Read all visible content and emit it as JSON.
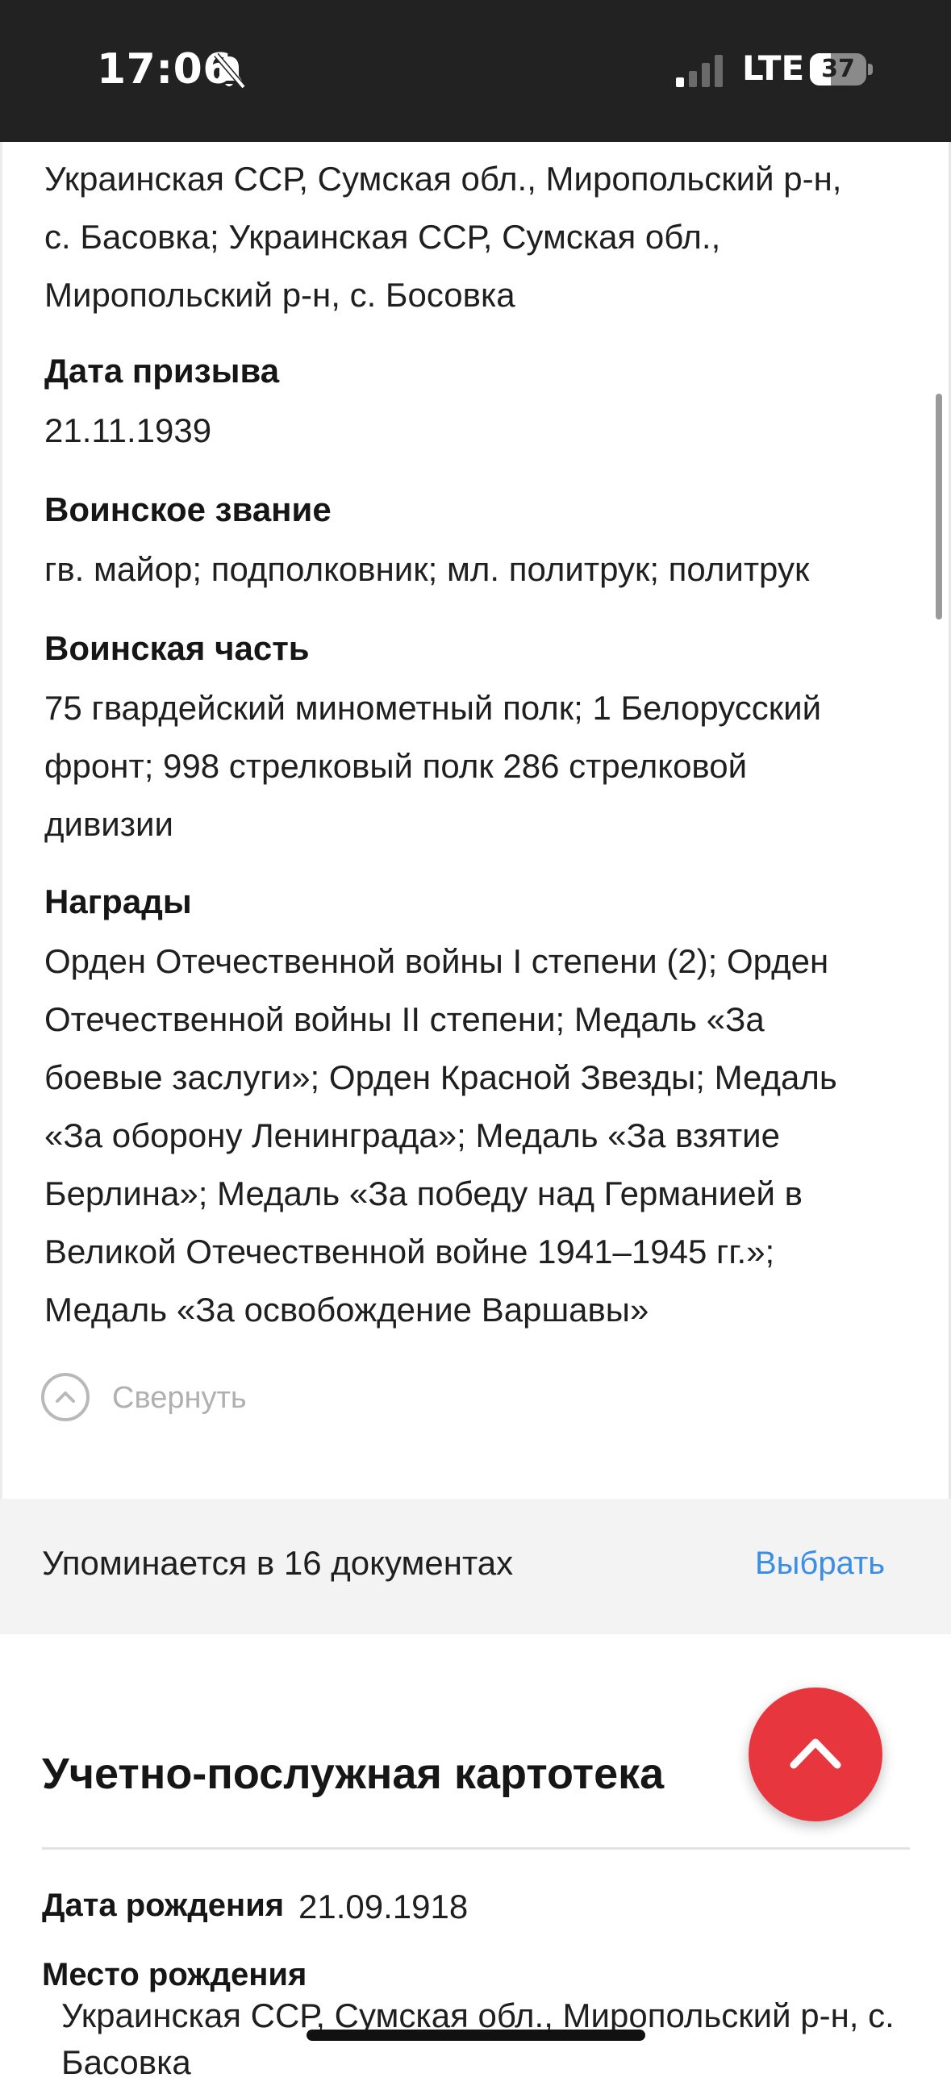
{
  "status_bar": {
    "time": "17:06",
    "network": "LTE",
    "battery_percent": "37",
    "battery_level": 0.37,
    "icons": [
      "bell-muted-icon",
      "signal-icon",
      "battery-icon"
    ]
  },
  "details": {
    "birthplace_text": [
      "Украинская ССР, Сумская обл., Миропольский р-н,",
      "с. Басовка; Украинская ССР, Сумская обл.,",
      "Миропольский р-н, с. Босовка"
    ],
    "conscription_label": "Дата призыва",
    "conscription_value": "21.11.1939",
    "rank_label": "Воинское звание",
    "rank_value": "гв. майор; подполковник; мл. политрук; политрук",
    "unit_label": "Воинская часть",
    "unit_value": [
      "75 гвардейский минометный полк; 1 Белорусский",
      "фронт; 998 стрелковый полк 286 стрелковой",
      "дивизии"
    ],
    "awards_label": "Награды",
    "awards_value": [
      "Орден Отечественной войны I степени (2); Орден",
      "Отечественной войны II степени; Медаль «За",
      "боевые заслуги»; Орден Красной Звезды; Медаль",
      "«За оборону Ленинграда»; Медаль «За взятие",
      "Берлина»; Медаль «За победу над Германией в",
      "Великой Отечественной войне 1941–1945 гг.»;",
      "Медаль «За освобождение Варшавы»"
    ],
    "collapse_label": "Свернуть"
  },
  "mentions": {
    "label": "Упоминается в 16 документах",
    "select_label": "Выбрать"
  },
  "card": {
    "title": "Учетно-послужная картотека",
    "dob_label": "Дата рождения",
    "dob_value": "21.09.1918",
    "pob_label": "Место рождения",
    "pob_value": "Украинская ССР, Сумская обл., Миропольский р-н, с. Басовка"
  },
  "colors": {
    "accent_link": "#3b8ee6",
    "fab": "#e8363f",
    "status_bar_bg": "#222222"
  }
}
